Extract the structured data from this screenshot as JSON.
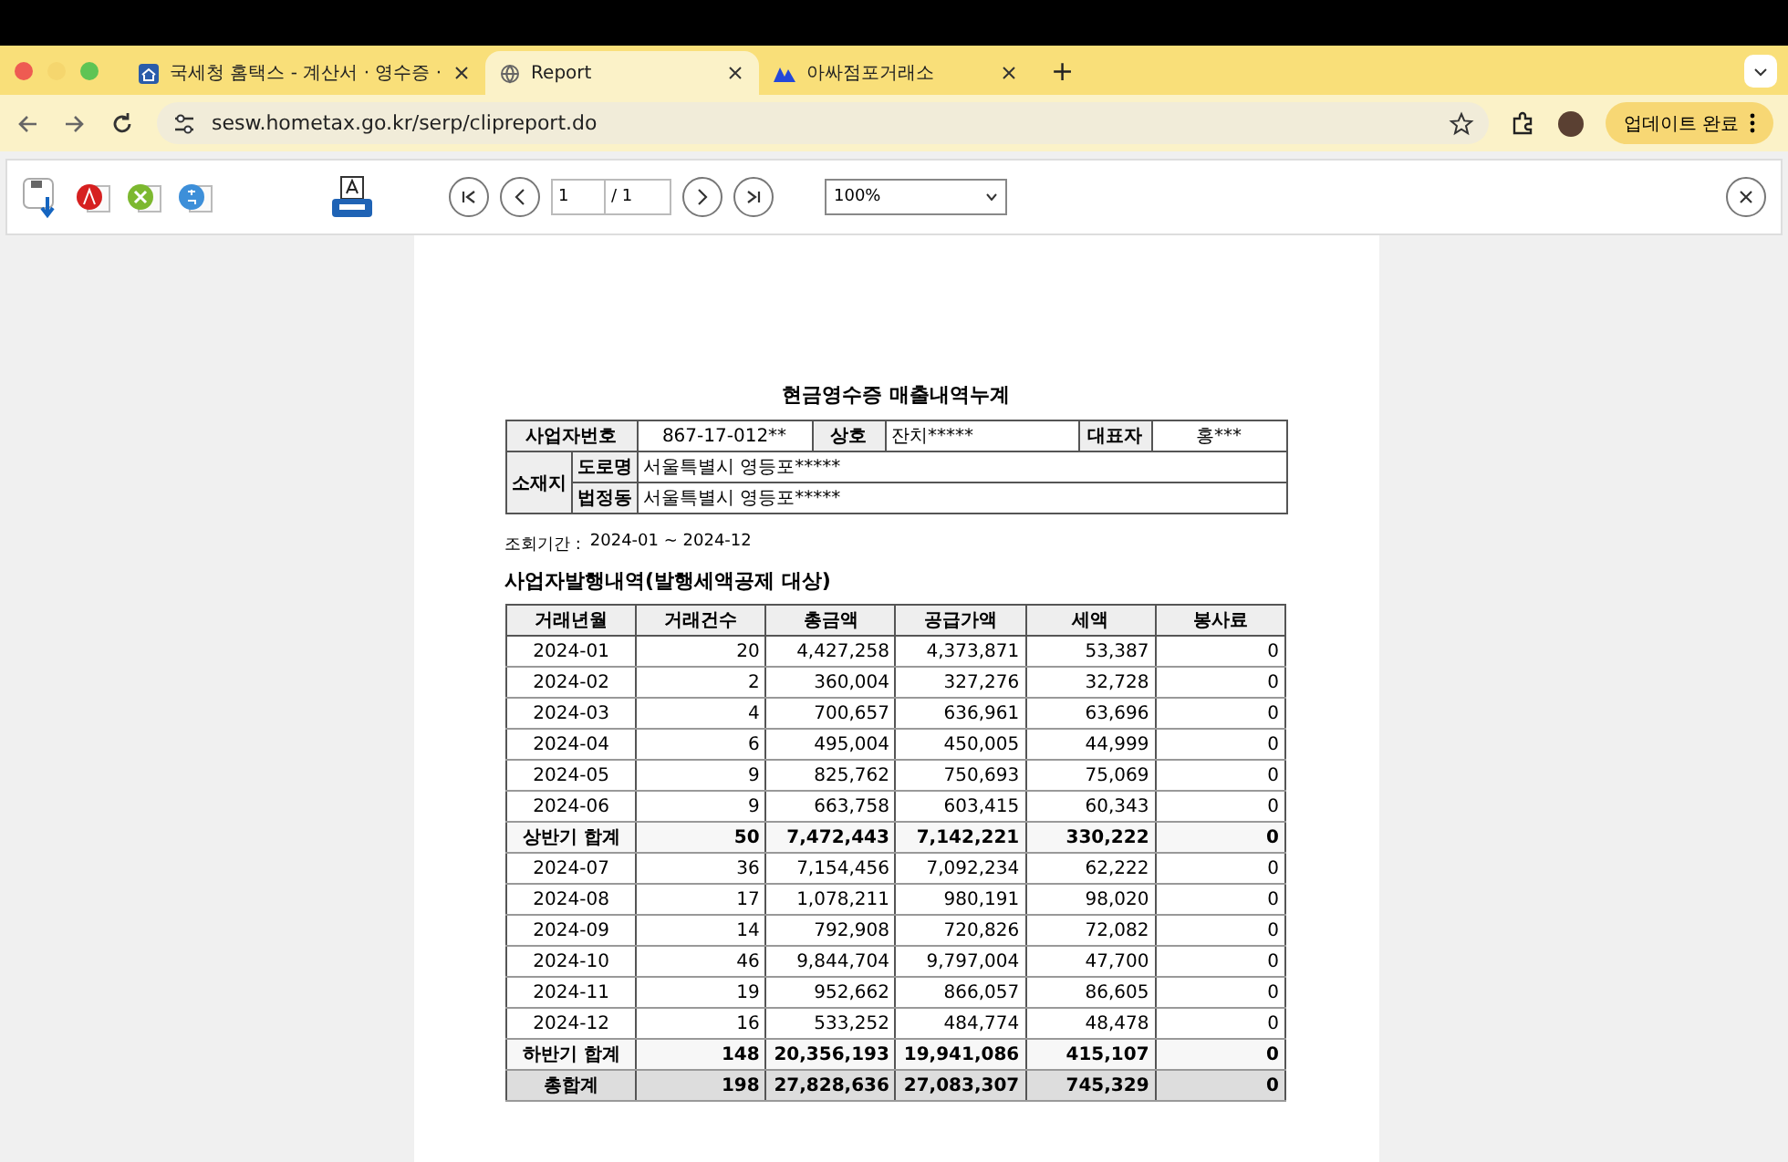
{
  "browser": {
    "tabs": [
      {
        "title": "국세청 홈택스 - 계산서 · 영수증 ·",
        "selected": false
      },
      {
        "title": "Report",
        "selected": true
      },
      {
        "title": "아싸점포거래소",
        "selected": false
      }
    ],
    "new_tab": "+",
    "url": "sesw.hometax.go.kr/serp/clipreport.do",
    "update_button": "업데이트 완료"
  },
  "viewer": {
    "page_input": "1",
    "page_total": "/ 1",
    "zoom": "100%"
  },
  "report": {
    "title": "현금영수증 매출내역누계",
    "fields": [
      {
        "label": "사업자번호",
        "value": "867-17-012**"
      },
      {
        "label": "상호",
        "value": "잔치*****"
      },
      {
        "label": "대표자",
        "value": "홍***"
      }
    ],
    "location_label": "소재지",
    "addresses": [
      {
        "label": "도로명",
        "value": "서울특별시 영등포*****"
      },
      {
        "label": "법정동",
        "value": "서울특별시 영등포*****"
      }
    ],
    "period_label": "조회기간 :",
    "period": "2024-01 ~ 2024-12",
    "section_title": "사업자발행내역(발행세액공제 대상)",
    "columns": [
      "거래년월",
      "거래건수",
      "총금액",
      "공급가액",
      "세액",
      "봉사료"
    ],
    "rows": [
      {
        "kind": "month",
        "cells": [
          "2024-01",
          "20",
          "4,427,258",
          "4,373,871",
          "53,387",
          "0"
        ]
      },
      {
        "kind": "month",
        "cells": [
          "2024-02",
          "2",
          "360,004",
          "327,276",
          "32,728",
          "0"
        ]
      },
      {
        "kind": "month",
        "cells": [
          "2024-03",
          "4",
          "700,657",
          "636,961",
          "63,696",
          "0"
        ]
      },
      {
        "kind": "month",
        "cells": [
          "2024-04",
          "6",
          "495,004",
          "450,005",
          "44,999",
          "0"
        ]
      },
      {
        "kind": "month",
        "cells": [
          "2024-05",
          "9",
          "825,762",
          "750,693",
          "75,069",
          "0"
        ]
      },
      {
        "kind": "month",
        "cells": [
          "2024-06",
          "9",
          "663,758",
          "603,415",
          "60,343",
          "0"
        ]
      },
      {
        "kind": "subtotal",
        "cells": [
          "상반기 합계",
          "50",
          "7,472,443",
          "7,142,221",
          "330,222",
          "0"
        ]
      },
      {
        "kind": "month",
        "cells": [
          "2024-07",
          "36",
          "7,154,456",
          "7,092,234",
          "62,222",
          "0"
        ]
      },
      {
        "kind": "month",
        "cells": [
          "2024-08",
          "17",
          "1,078,211",
          "980,191",
          "98,020",
          "0"
        ]
      },
      {
        "kind": "month",
        "cells": [
          "2024-09",
          "14",
          "792,908",
          "720,826",
          "72,082",
          "0"
        ]
      },
      {
        "kind": "month",
        "cells": [
          "2024-10",
          "46",
          "9,844,704",
          "9,797,004",
          "47,700",
          "0"
        ]
      },
      {
        "kind": "month",
        "cells": [
          "2024-11",
          "19",
          "952,662",
          "866,057",
          "86,605",
          "0"
        ]
      },
      {
        "kind": "month",
        "cells": [
          "2024-12",
          "16",
          "533,252",
          "484,774",
          "48,478",
          "0"
        ]
      },
      {
        "kind": "subtotal",
        "cells": [
          "하반기 합계",
          "148",
          "20,356,193",
          "19,941,086",
          "415,107",
          "0"
        ]
      },
      {
        "kind": "total",
        "cells": [
          "총합계",
          "198",
          "27,828,636",
          "27,083,307",
          "745,329",
          "0"
        ]
      }
    ]
  }
}
